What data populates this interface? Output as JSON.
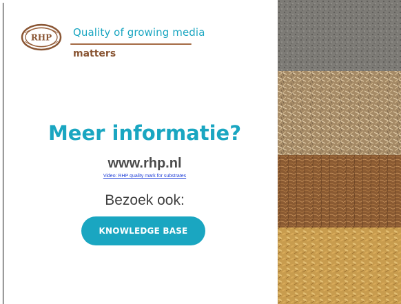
{
  "logo": {
    "initials": "RHP",
    "tagline_top": "Quality of growing media",
    "tagline_bottom": "matters"
  },
  "content": {
    "headline": "Meer informatie?",
    "website": "www.rhp.nl",
    "video_link": "Video: RHP quality mark for substrates",
    "visit_label": "Bezoek ook:",
    "button_label": "KNOWLEDGE BASE"
  },
  "photos": [
    {
      "name": "soil-photo",
      "color": "#7d7b76"
    },
    {
      "name": "straw-fiber-photo",
      "color": "#b99a72"
    },
    {
      "name": "coir-fiber-photo",
      "color": "#8a5a32"
    },
    {
      "name": "rice-husk-photo",
      "color": "#c89c4e"
    }
  ],
  "colors": {
    "accent": "#1aa6c1",
    "brown": "#8a5634"
  }
}
